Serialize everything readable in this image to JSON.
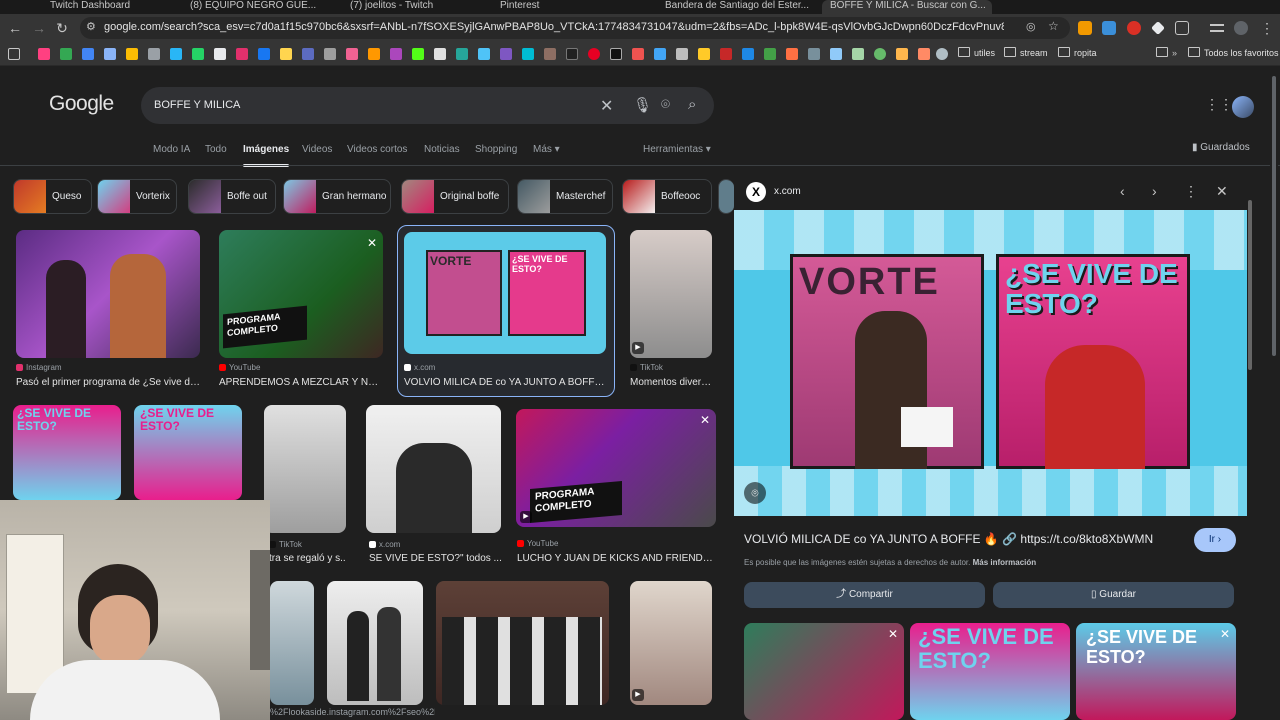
{
  "browser": {
    "tabs": [
      {
        "label": "Twitch Dashboard",
        "active": false
      },
      {
        "label": "(8) EQUIPO NEGRO GUE...",
        "active": false
      },
      {
        "label": "(7) joelitos - Twitch",
        "active": false
      },
      {
        "label": "Pinterest",
        "active": false
      },
      {
        "label": "Bandera de Santiago del Ester...",
        "active": false
      },
      {
        "label": "BOFFE Y MILICA - Buscar con G...",
        "active": true
      }
    ],
    "url": "google.com/search?sca_esv=c7d0a1f15c970bc6&sxsrf=ANbL-n7fSOXESyjlGAnwPBAP8Uo_VTCkA:1774834731047&udm=2&fbs=ADc_l-bpk8W4E-qsVlOvbGJcDwpn60DczFdcvPnuv8WQohHLTaf9fS4tU71bi2aHS-Pmeg3gf3...",
    "bookmark_folders": [
      "utiles",
      "stream",
      "ropita"
    ],
    "all_favorites": "Todos los favoritos"
  },
  "google": {
    "logo": "Google",
    "query": "BOFFE Y MILICA",
    "tabs": [
      "Modo IA",
      "Todo",
      "Imágenes",
      "Videos",
      "Videos cortos",
      "Noticias",
      "Shopping",
      "Más"
    ],
    "active_tab": "Imágenes",
    "tools": "Herramientas",
    "saved": "Guardados"
  },
  "chips": [
    "Queso",
    "Vorterix",
    "Boffe out",
    "Gran hermano",
    "Original boffe",
    "Masterchef",
    "Boffeooc"
  ],
  "results": [
    {
      "source": "Instagram",
      "title": "Pasó el primer programa de ¿Se vive de..."
    },
    {
      "source": "YouTube",
      "title": "APRENDEMOS A MEZCLAR Y NUE..."
    },
    {
      "source": "x.com",
      "title": "VOLVIÓ MILICA DE co YA JUNTO A BOFFE ..."
    },
    {
      "source": "TikTok",
      "title": "Momentos divertid..."
    },
    {
      "source": "TikTok",
      "title": "tra se regaló y s..."
    },
    {
      "source": "x.com",
      "title": "SE VIVE DE ESTO?\" todos ..."
    },
    {
      "source": "YouTube",
      "title": "LUCHO Y JUAN DE KICKS AND FRIENDS ..."
    },
    {
      "source": "",
      "title": "%2Flookaside.instagram.com%2Fseo%2F..."
    }
  ],
  "thumb_texts": {
    "programa_completo": "PROGRAMA COMPLETO",
    "se_vive": "¿SE VIVE DE ESTO?",
    "vorte": "VORTE"
  },
  "panel": {
    "site": "x.com",
    "title": "VOLVIÓ MILICA DE co YA JUNTO A BOFFE 🔥 🔗 https://t.co/8kto8XbWMN",
    "note": "Es posible que las imágenes estén sujetas a derechos de autor.",
    "note_link": "Más información",
    "visit": "Ir",
    "share": "Compartir",
    "save": "Guardar"
  }
}
